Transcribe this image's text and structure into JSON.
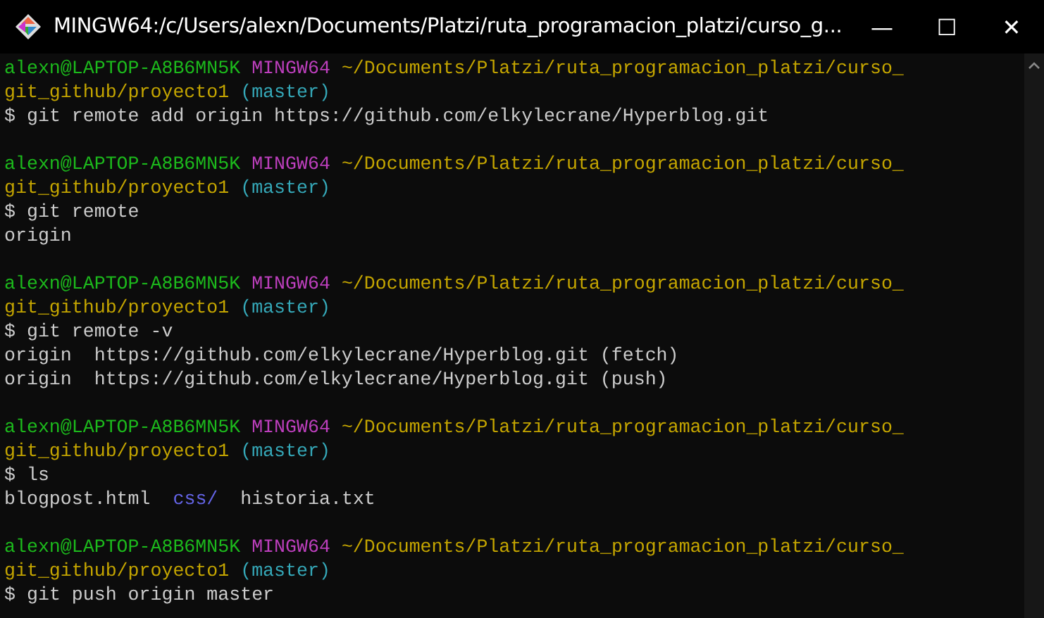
{
  "window": {
    "title": "MINGW64:/c/Users/alexn/Documents/Platzi/ruta_programacion_platzi/curso_g...",
    "controls": [
      "—",
      "☐",
      "✕"
    ]
  },
  "terminal": {
    "lines": [
      {
        "kind": "prompt",
        "user": "alexn@LAPTOP-A8B6MN5K",
        "system": "MINGW64",
        "path": "~/Documents/Platzi/ruta_programacion_platzi/curso_",
        "path_continued": "git_github/proyecto1",
        "branch": "(master)"
      },
      {
        "kind": "command",
        "prompt": "$",
        "text": "git remote add origin https://github.com/elkylecrane/Hyperblog.git"
      },
      {
        "kind": "blank"
      },
      {
        "kind": "prompt",
        "user": "alexn@LAPTOP-A8B6MN5K",
        "system": "MINGW64",
        "path": "~/Documents/Platzi/ruta_programacion_platzi/curso_",
        "path_continued": "git_github/proyecto1",
        "branch": "(master)"
      },
      {
        "kind": "command",
        "prompt": "$",
        "text": "git remote"
      },
      {
        "kind": "output",
        "segments": [
          {
            "kind": "file",
            "text": "origin"
          }
        ]
      },
      {
        "kind": "blank"
      },
      {
        "kind": "prompt",
        "user": "alexn@LAPTOP-A8B6MN5K",
        "system": "MINGW64",
        "path": "~/Documents/Platzi/ruta_programacion_platzi/curso_",
        "path_continued": "git_github/proyecto1",
        "branch": "(master)"
      },
      {
        "kind": "command",
        "prompt": "$",
        "text": "git remote -v"
      },
      {
        "kind": "output",
        "segments": [
          {
            "kind": "file",
            "text": "origin  https://github.com/elkylecrane/Hyperblog.git (fetch)"
          }
        ]
      },
      {
        "kind": "output",
        "segments": [
          {
            "kind": "file",
            "text": "origin  https://github.com/elkylecrane/Hyperblog.git (push)"
          }
        ]
      },
      {
        "kind": "blank"
      },
      {
        "kind": "prompt",
        "user": "alexn@LAPTOP-A8B6MN5K",
        "system": "MINGW64",
        "path": "~/Documents/Platzi/ruta_programacion_platzi/curso_",
        "path_continued": "git_github/proyecto1",
        "branch": "(master)"
      },
      {
        "kind": "command",
        "prompt": "$",
        "text": "ls"
      },
      {
        "kind": "output",
        "segments": [
          {
            "kind": "file",
            "text": "blogpost.html"
          },
          {
            "kind": "directory",
            "text": "css/"
          },
          {
            "kind": "file",
            "text": "historia.txt"
          }
        ]
      },
      {
        "kind": "blank"
      },
      {
        "kind": "prompt",
        "user": "alexn@LAPTOP-A8B6MN5K",
        "system": "MINGW64",
        "path": "~/Documents/Platzi/ruta_programacion_platzi/curso_",
        "path_continued": "git_github/proyecto1",
        "branch": "(master)"
      },
      {
        "kind": "command",
        "prompt": "$",
        "text": "git push origin master"
      }
    ]
  }
}
